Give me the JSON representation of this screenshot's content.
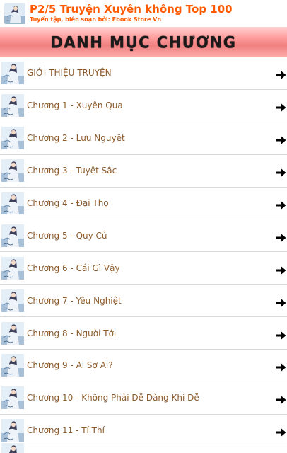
{
  "header": {
    "title": "P2/5 Truyện Xuyên không Top 100",
    "subtitle": "Tuyển tập, biên soạn bởi: Ebook Store Vn",
    "logo_icon": "book-cover-icon"
  },
  "banner": {
    "title": "DANH MỤC CHƯƠNG"
  },
  "colors": {
    "header_text": "#ff5a00",
    "item_text": "#8b5a2b",
    "banner_mid": "#f08080",
    "arrow": "#000000"
  },
  "chapters": [
    {
      "label": "GIỚI THIỆU TRUYỆN"
    },
    {
      "label": "Chương 1 - Xuyên Qua"
    },
    {
      "label": "Chương 2 - Lưu Nguyệt"
    },
    {
      "label": "Chương 3 - Tuyệt Sắc"
    },
    {
      "label": "Chương 4 - Đại Thọ"
    },
    {
      "label": "Chương 5 - Quy Củ"
    },
    {
      "label": "Chương 6 - Cái Gì Vậy"
    },
    {
      "label": "Chương 7 - Yêu Nghiệt"
    },
    {
      "label": "Chương 8 - Người Tới"
    },
    {
      "label": "Chương 9 - Ai Sợ Ai?"
    },
    {
      "label": "Chương 10 - Không Phải Dễ Dàng Khi Dễ"
    },
    {
      "label": "Chương 11 - Tí Thí"
    }
  ]
}
